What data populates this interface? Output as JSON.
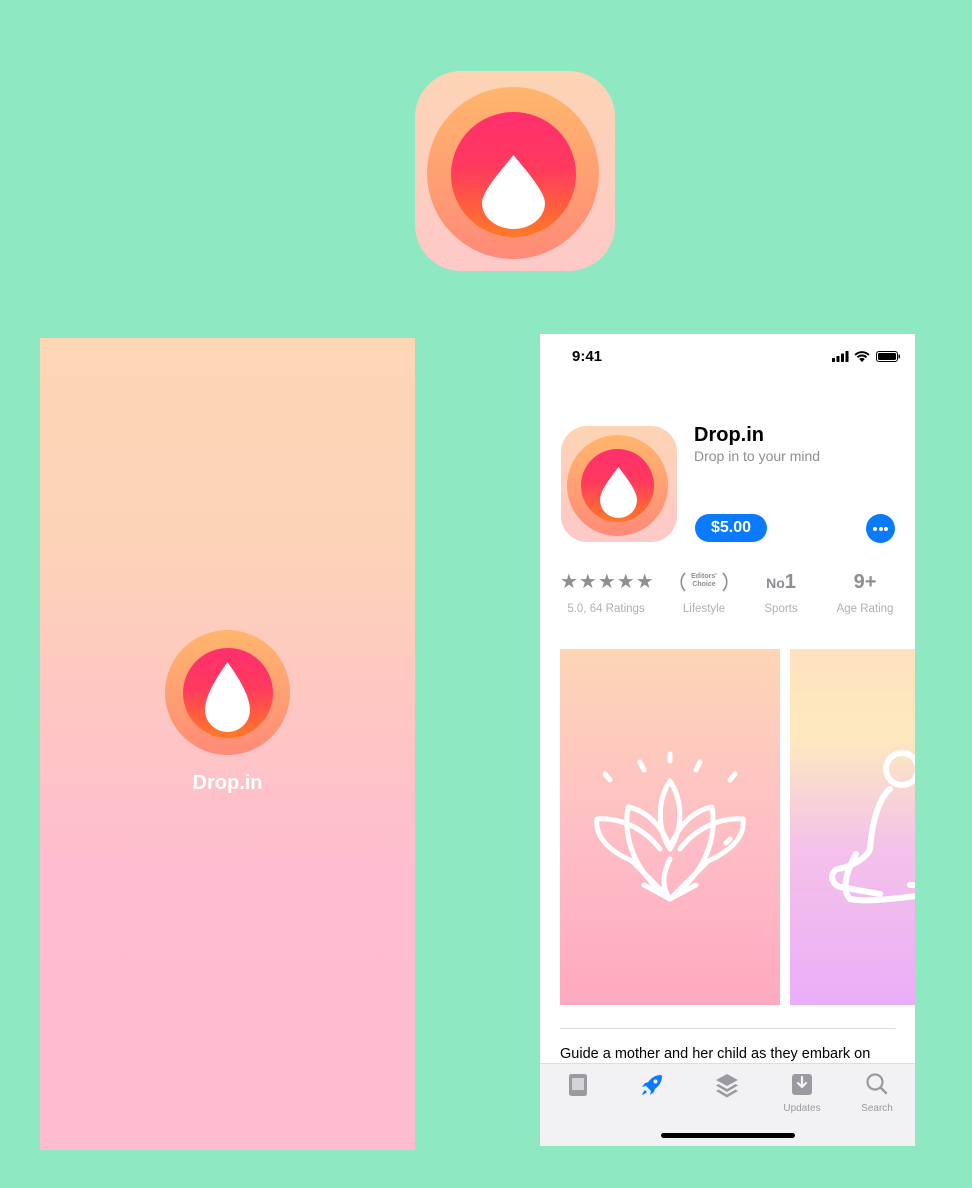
{
  "splash": {
    "app_name": "Drop.in"
  },
  "store": {
    "status_time": "9:41",
    "app_name": "Drop.in",
    "app_subtitle": "Drop in to your mind",
    "price": "$5.00",
    "stats": {
      "rating": {
        "value": "★★★★★",
        "label": "5.0, 64 Ratings"
      },
      "editors": {
        "badge_line1": "Editors'",
        "badge_line2": "Choice",
        "label": "Lifestyle"
      },
      "rank": {
        "prefix": "No",
        "value": "1",
        "label": "Sports"
      },
      "age": {
        "value": "9+",
        "label": "Age Rating"
      }
    },
    "description": "Guide a mother and her child as they embark on",
    "tabs": [
      {
        "icon": "today-icon",
        "label": ""
      },
      {
        "icon": "rocket-icon",
        "label": ""
      },
      {
        "icon": "layers-icon",
        "label": ""
      },
      {
        "icon": "updates-icon",
        "label": "Updates"
      },
      {
        "icon": "search-icon",
        "label": "Search"
      }
    ]
  },
  "colors": {
    "background": "#8ee8c1",
    "accent": "#0a7aff",
    "icon_core": "#ff2f6e",
    "icon_ring": "#ffb66d"
  }
}
